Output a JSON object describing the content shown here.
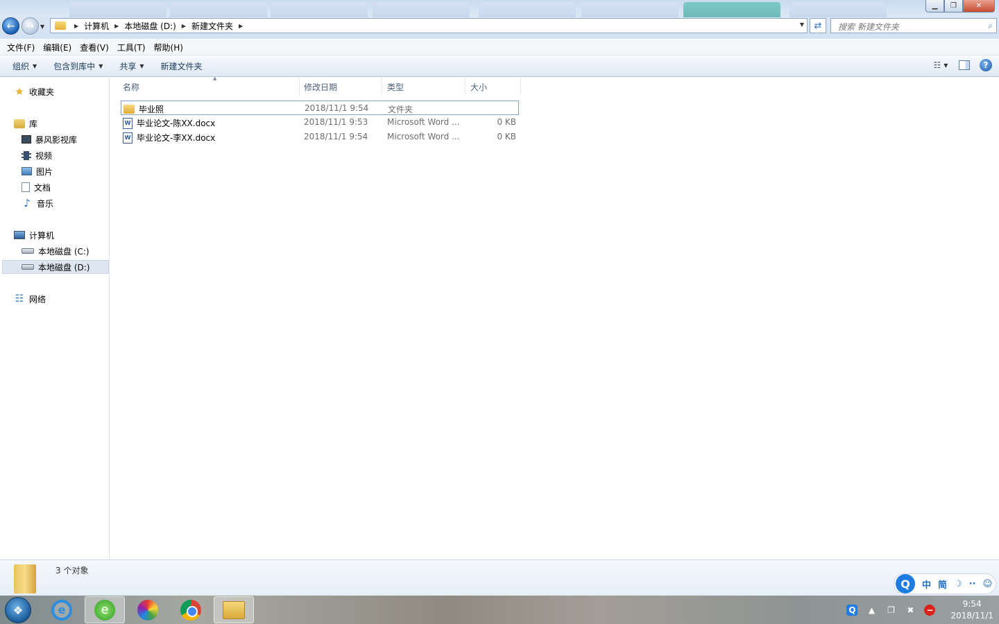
{
  "address": {
    "crumbs": [
      "计算机",
      "本地磁盘 (D:)",
      "新建文件夹"
    ],
    "search_placeholder": "搜索 新建文件夹"
  },
  "menu": [
    "文件(F)",
    "编辑(E)",
    "查看(V)",
    "工具(T)",
    "帮助(H)"
  ],
  "commands": {
    "organize": "组织",
    "include": "包含到库中",
    "share": "共享",
    "new_folder": "新建文件夹"
  },
  "sidebar": {
    "favorites": "收藏夹",
    "library": "库",
    "library_items": [
      "暴风影视库",
      "视频",
      "图片",
      "文档",
      "音乐"
    ],
    "computer": "计算机",
    "drives": [
      "本地磁盘 (C:)",
      "本地磁盘 (D:)"
    ],
    "network": "网络"
  },
  "columns": {
    "name": "名称",
    "date": "修改日期",
    "type": "类型",
    "size": "大小"
  },
  "files": [
    {
      "name": "毕业照",
      "date": "2018/11/1 9:54",
      "type": "文件夹",
      "size": "",
      "icon": "folder-icon"
    },
    {
      "name": "毕业论文-陈XX.docx",
      "date": "2018/11/1 9:53",
      "type": "Microsoft Word ...",
      "size": "0 KB",
      "icon": "word-doc-icon"
    },
    {
      "name": "毕业论文-李XX.docx",
      "date": "2018/11/1 9:54",
      "type": "Microsoft Word ...",
      "size": "0 KB",
      "icon": "word-doc-icon"
    }
  ],
  "status": {
    "count": "3 个对象"
  },
  "ime": {
    "chinese": "中",
    "simplified": "简"
  },
  "clock": {
    "time": "9:54",
    "date": "2018/11/1"
  }
}
